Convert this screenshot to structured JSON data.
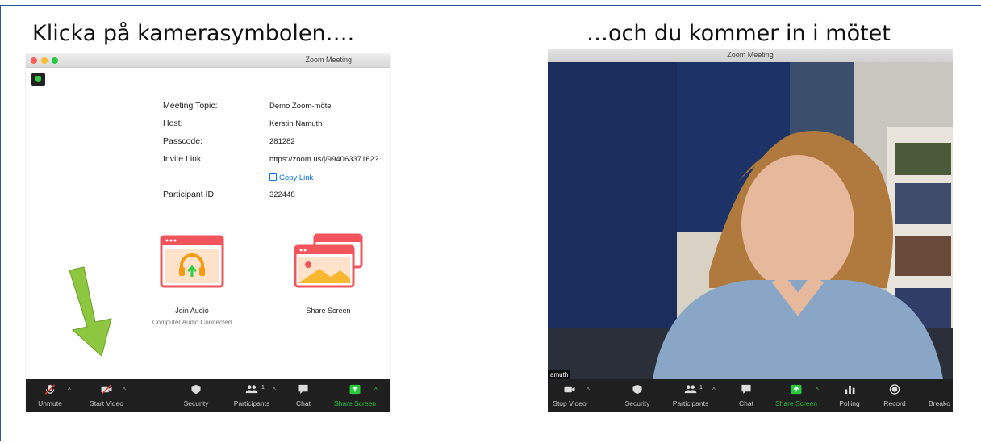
{
  "headings": {
    "left": "Klicka på kamerasymbolen….",
    "right": "…och du kommer in i mötet"
  },
  "left_window": {
    "title": "Zoom Meeting",
    "info": [
      {
        "label": "Meeting Topic:",
        "value": "Demo Zoom-möte"
      },
      {
        "label": "Host:",
        "value": "Kerstin Namuth"
      },
      {
        "label": "Passcode:",
        "value": "281282"
      },
      {
        "label": "Invite Link:",
        "value": "https://zoom.us/j/99406337162?"
      },
      {
        "label": "Participant ID:",
        "value": "322448"
      }
    ],
    "copy_link": "Copy Link",
    "join_audio": {
      "label": "Join Audio",
      "sub": "Computer Audio Connected"
    },
    "share_screen": {
      "label": "Share Screen"
    },
    "toolbar": {
      "unmute": "Unmute",
      "start_video": "Start Video",
      "security": "Security",
      "participants": "Participants",
      "participants_count": "1",
      "chat": "Chat",
      "share_screen": "Share Screen"
    }
  },
  "right_window": {
    "title": "Zoom Meeting",
    "name_label": "amuth",
    "toolbar": {
      "stop_video": "Stop Video",
      "security": "Security",
      "participants": "Participants",
      "participants_count": "1",
      "chat": "Chat",
      "share_screen": "Share Screen",
      "polling": "Polling",
      "record": "Record",
      "breakout": "Breako"
    }
  },
  "colors": {
    "accent_green": "#28c840",
    "link_blue": "#0e71eb",
    "arrow_green": "#8dc63f",
    "tile_red": "#f2545b",
    "slide_border": "#2f5597"
  }
}
